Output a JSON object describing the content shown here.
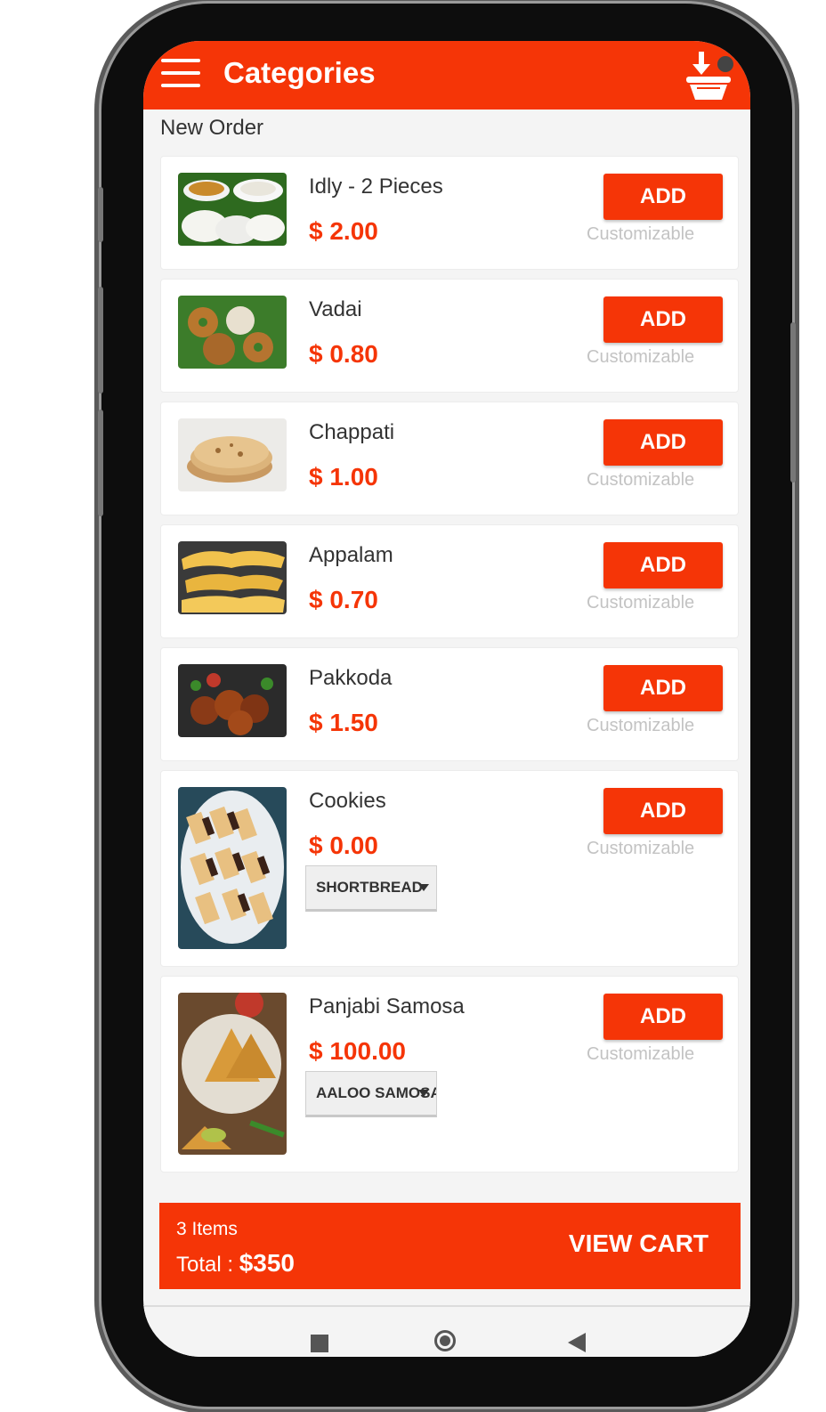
{
  "appbar": {
    "title": "Categories",
    "menu_icon": "hamburger-icon",
    "cart_icon": "basket-download-icon"
  },
  "section": {
    "label": "New Order"
  },
  "colors": {
    "accent": "#f53507",
    "muted": "#c3c3c3"
  },
  "items": [
    {
      "name": "Idly - 2 Pieces",
      "price": "$ 2.00",
      "add": "ADD",
      "note": "Customizable"
    },
    {
      "name": "Vadai",
      "price": "$ 0.80",
      "add": "ADD",
      "note": "Customizable"
    },
    {
      "name": "Chappati",
      "price": "$ 1.00",
      "add": "ADD",
      "note": "Customizable"
    },
    {
      "name": "Appalam",
      "price": "$ 0.70",
      "add": "ADD",
      "note": "Customizable"
    },
    {
      "name": "Pakkoda",
      "price": "$ 1.50",
      "add": "ADD",
      "note": "Customizable"
    },
    {
      "name": "Cookies",
      "price": "$ 0.00",
      "add": "ADD",
      "note": "Customizable",
      "option": "SHORTBREAD"
    },
    {
      "name": "Panjabi Samosa",
      "price": "$ 100.00",
      "add": "ADD",
      "note": "Customizable",
      "option": "AALOO SAMOSA"
    }
  ],
  "cart": {
    "count": "3 Items",
    "total_label": "Total : ",
    "total_value": "$350",
    "view": "VIEW CART"
  }
}
